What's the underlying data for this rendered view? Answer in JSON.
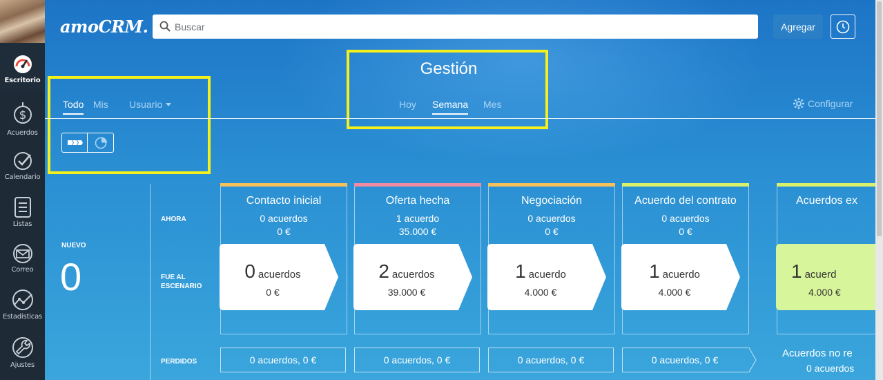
{
  "sidebar": {
    "items": [
      {
        "label": "Escritorio",
        "icon": "dashboard-icon",
        "active": true
      },
      {
        "label": "Acuerdos",
        "icon": "dollar-icon",
        "active": false
      },
      {
        "label": "Calendario",
        "icon": "check-icon",
        "active": false
      },
      {
        "label": "Listas",
        "icon": "list-icon",
        "active": false
      },
      {
        "label": "Correo",
        "icon": "mail-icon",
        "active": false
      },
      {
        "label": "Estadísticas",
        "icon": "stats-icon",
        "active": false
      },
      {
        "label": "Ajustes",
        "icon": "wrench-icon",
        "active": false
      }
    ]
  },
  "header": {
    "logo": "amoCRM.",
    "search_placeholder": "Buscar",
    "add_label": "Agregar"
  },
  "page": {
    "title": "Gestión",
    "period_tabs": [
      "Hoy",
      "Semana",
      "Mes"
    ],
    "active_period": "Semana",
    "filter_tabs": [
      "Todo",
      "Mis"
    ],
    "active_filter": "Todo",
    "user_filter": "Usuario",
    "configure_label": "Configurar"
  },
  "row_labels": {
    "now": "AHORA",
    "moved_line1": "FUE AL",
    "moved_line2": "ESCENARIO",
    "lost": "PERDIDOS"
  },
  "nuevo": {
    "label": "NUEVO",
    "value": "0"
  },
  "stages": [
    {
      "name": "Contacto inicial",
      "now_count": "0 acuerdos",
      "now_sum": "0 €",
      "moved_count": "0",
      "moved_word": "acuerdos",
      "moved_sum": "0 €",
      "lost": "0 acuerdos, 0 €",
      "color": "#f5c15a"
    },
    {
      "name": "Oferta hecha",
      "now_count": "1 acuerdo",
      "now_sum": "35.000 €",
      "moved_count": "2",
      "moved_word": "acuerdos",
      "moved_sum": "39.000 €",
      "lost": "0 acuerdos, 0 €",
      "color": "#f08aa0"
    },
    {
      "name": "Negociación",
      "now_count": "0 acuerdos",
      "now_sum": "0 €",
      "moved_count": "1",
      "moved_word": "acuerdo",
      "moved_sum": "4.000 €",
      "lost": "0 acuerdos, 0 €",
      "color": "#f5c15a"
    },
    {
      "name": "Acuerdo del contrato",
      "now_count": "0 acuerdos",
      "now_sum": "0 €",
      "moved_count": "1",
      "moved_word": "acuerdo",
      "moved_sum": "4.000 €",
      "lost": "0 acuerdos, 0 €",
      "color": "#d8f06a"
    },
    {
      "name": "Acuerdos ex",
      "now_count": "",
      "now_sum": "",
      "moved_count": "1",
      "moved_word": "acuerd",
      "moved_sum": "4.000 €",
      "lost": "",
      "color": "#d8f06a"
    }
  ],
  "extra_lost": {
    "title": "Acuerdos no re",
    "sub": "0 acuerdos"
  },
  "colors": {
    "highlight": "#f6f01a",
    "won_card": "#d7f59a"
  }
}
